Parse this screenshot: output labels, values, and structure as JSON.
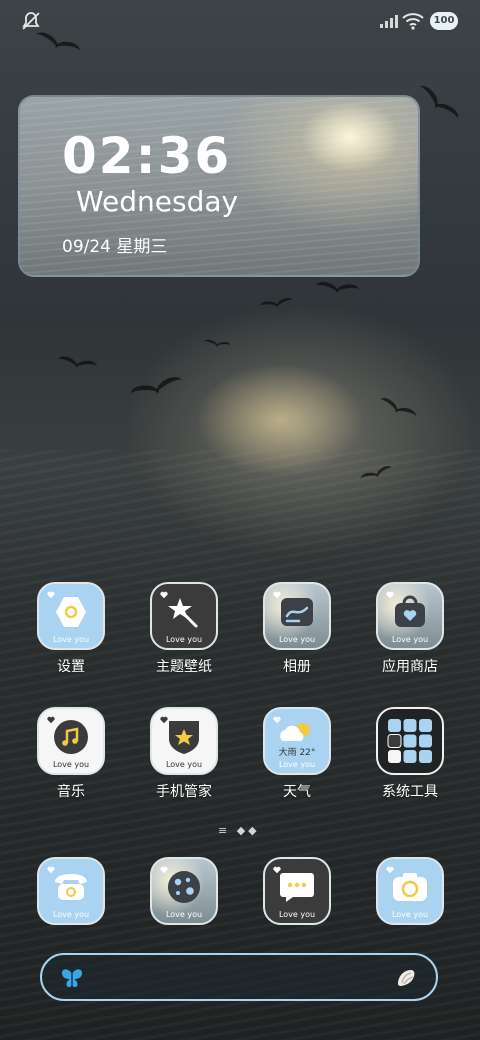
{
  "status": {
    "battery": "100"
  },
  "widget": {
    "time": "02:36",
    "weekday": "Wednesday",
    "date": "09/24 星期三"
  },
  "apps_row1": [
    {
      "label": "设置",
      "caption": "Love you"
    },
    {
      "label": "主题壁纸",
      "caption": "Love you"
    },
    {
      "label": "相册",
      "caption": "Love you"
    },
    {
      "label": "应用商店",
      "caption": "Love you"
    }
  ],
  "apps_row2": [
    {
      "label": "音乐",
      "caption": "Love you"
    },
    {
      "label": "手机管家",
      "caption": "Love you"
    },
    {
      "label": "天气",
      "caption": "Love you",
      "weather": "大雨 22°"
    },
    {
      "label": "系统工具"
    }
  ],
  "dock": [
    {
      "name": "phone",
      "caption": "Love you"
    },
    {
      "name": "browser",
      "caption": "Love you"
    },
    {
      "name": "messages",
      "caption": "Love you"
    },
    {
      "name": "camera",
      "caption": "Love you"
    }
  ],
  "colors": {
    "accent": "#a9d3f0",
    "dark_icon": "#3b3b3b",
    "widget_border": "#78889b"
  }
}
